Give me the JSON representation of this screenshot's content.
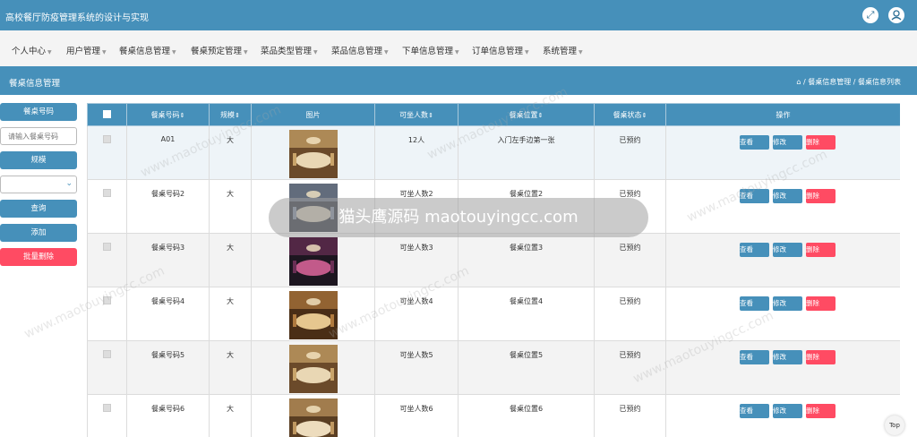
{
  "app": {
    "title": "高校餐厅防疫管理系统的设计与实现",
    "fullscreen_icon": "expand-icon",
    "user_icon": "user-icon"
  },
  "nav": [
    {
      "label": "个人中心"
    },
    {
      "label": "用户管理"
    },
    {
      "label": "餐桌信息管理"
    },
    {
      "label": "餐桌预定管理"
    },
    {
      "label": "菜品类型管理"
    },
    {
      "label": "菜品信息管理"
    },
    {
      "label": "下单信息管理"
    },
    {
      "label": "订单信息管理"
    },
    {
      "label": "系统管理"
    }
  ],
  "page": {
    "title": "餐桌信息管理",
    "breadcrumb": [
      "餐桌信息管理",
      "餐桌信息列表"
    ]
  },
  "search": {
    "code_label": "餐桌号码",
    "code_placeholder": "请输入餐桌号码",
    "size_label": "规模",
    "size_value": "",
    "query_button": "查询",
    "add_button": "添加",
    "batch_delete_button": "批量删除"
  },
  "table": {
    "headers": [
      "",
      "餐桌号码",
      "规模",
      "图片",
      "可坐人数",
      "餐桌位置",
      "餐桌状态",
      "操作"
    ],
    "actions": {
      "view": "查看",
      "edit": "修改",
      "delete": "删除"
    },
    "rows": [
      {
        "code": "A01",
        "size": "大",
        "seats": "12人",
        "location": "入门左手边第一张",
        "status": "已预约"
      },
      {
        "code": "餐桌号码2",
        "size": "大",
        "seats": "可坐人数2",
        "location": "餐桌位置2",
        "status": "已预约"
      },
      {
        "code": "餐桌号码3",
        "size": "大",
        "seats": "可坐人数3",
        "location": "餐桌位置3",
        "status": "已预约"
      },
      {
        "code": "餐桌号码4",
        "size": "大",
        "seats": "可坐人数4",
        "location": "餐桌位置4",
        "status": "已预约"
      },
      {
        "code": "餐桌号码5",
        "size": "大",
        "seats": "可坐人数5",
        "location": "餐桌位置5",
        "status": "已预约"
      },
      {
        "code": "餐桌号码6",
        "size": "大",
        "seats": "可坐人数6",
        "location": "餐桌位置6",
        "status": "已预约"
      }
    ]
  },
  "overlay": {
    "banner": "猫头鹰源码 maotouyingcc.com",
    "watermark": "www.maotouyingcc.com"
  },
  "back_to_top": "Top"
}
